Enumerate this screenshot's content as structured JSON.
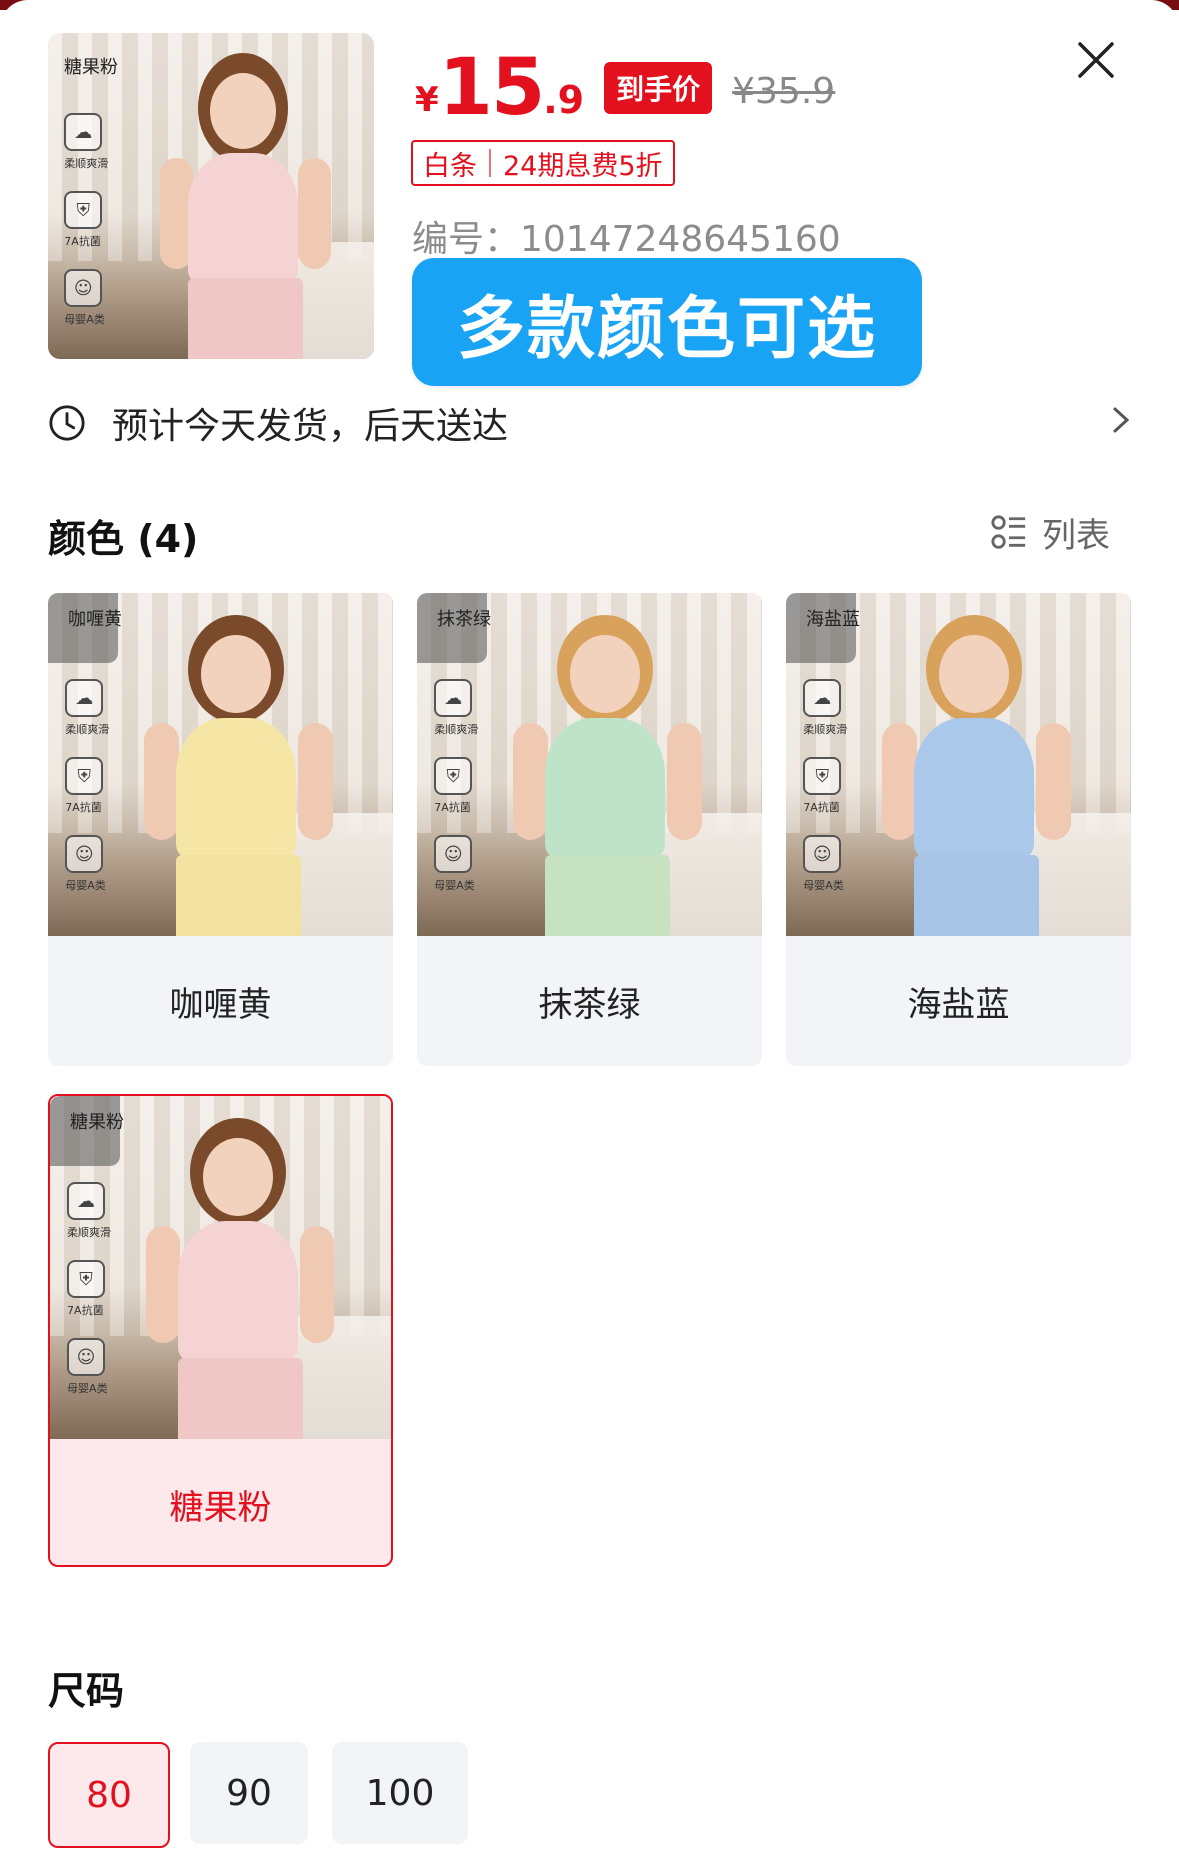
{
  "header": {
    "price": {
      "currency": "¥",
      "integer": "15",
      "decimal": ".9"
    },
    "price_tag": "到手价",
    "original_price": "¥35.9",
    "installment": {
      "provider": "白条",
      "offer": "24期息费5折"
    },
    "item_code": "编号：10147248645160",
    "promo_banner": "多款颜色可选"
  },
  "thumbnail": {
    "tag": "糖果粉",
    "badges": [
      "柔顺爽滑",
      "7A抗菌",
      "母婴A类"
    ]
  },
  "shipping": {
    "text": "预计今天发货，后天送达"
  },
  "color_section": {
    "title": "颜色 (4)",
    "view_toggle": "列表",
    "options": [
      {
        "name": "咖喱黄",
        "tag": "咖喱黄",
        "selected": false,
        "shirt_color": "#f5e6a5",
        "pants_color": "#f2e2a0",
        "hair": "#7a4a2a"
      },
      {
        "name": "抹茶绿",
        "tag": "抹茶绿",
        "selected": false,
        "shirt_color": "#bfe3c8",
        "pants_color": "#c6e2c0",
        "hair": "#d8a25c"
      },
      {
        "name": "海盐蓝",
        "tag": "海盐蓝",
        "selected": false,
        "shirt_color": "#a9c8ea",
        "pants_color": "#a7c4e6",
        "hair": "#d8a25c"
      },
      {
        "name": "糖果粉",
        "tag": "糖果粉",
        "selected": true,
        "shirt_color": "#f6d3d3",
        "pants_color": "#efc7c7",
        "hair": "#7a4a2a"
      }
    ]
  },
  "size_section": {
    "title": "尺码",
    "options": [
      {
        "label": "80",
        "selected": true
      },
      {
        "label": "90",
        "selected": false
      },
      {
        "label": "100",
        "selected": false
      }
    ]
  },
  "colors": {
    "accent_red": "#e3101e",
    "promo_blue": "#18a3f5"
  }
}
